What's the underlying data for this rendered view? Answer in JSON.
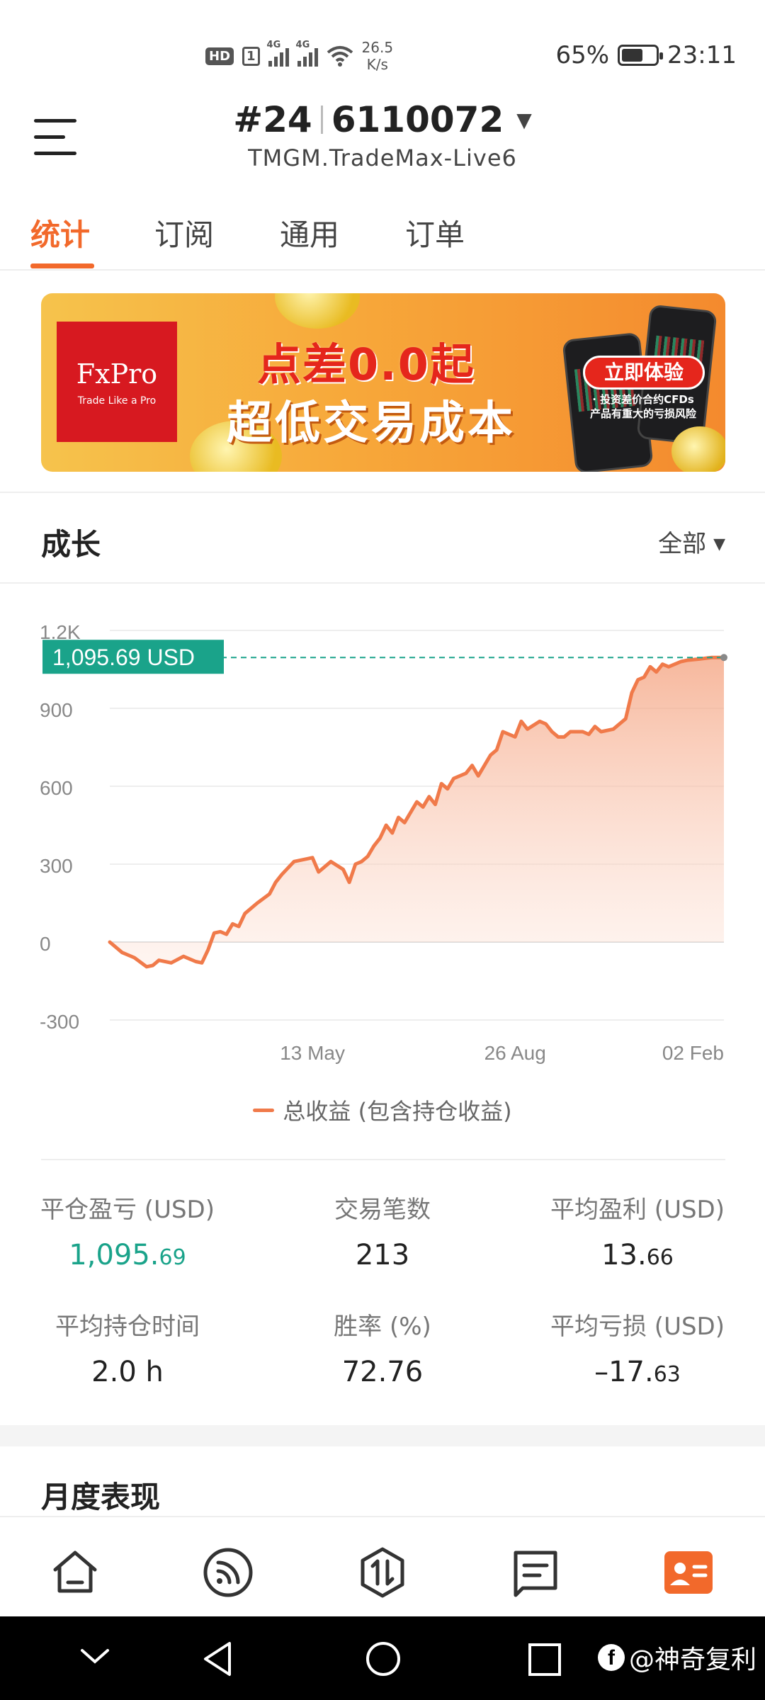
{
  "status_bar": {
    "hd": "HD",
    "sim": "1",
    "net1": "4G",
    "net2": "4G",
    "speed_value": "26.5",
    "speed_unit": "K/s",
    "battery": "65%",
    "time": "23:11"
  },
  "header": {
    "account_index": "#24",
    "account_number": "6110072",
    "server": "TMGM.TradeMax-Live6"
  },
  "tabs": [
    {
      "label": "统计",
      "active": true
    },
    {
      "label": "订阅",
      "active": false
    },
    {
      "label": "通用",
      "active": false
    },
    {
      "label": "订单",
      "active": false
    }
  ],
  "banner": {
    "brand": "FxPro",
    "brand_tagline": "Trade Like a Pro",
    "line1": "点差0.0起",
    "line2": "超低交易成本",
    "cta": "立即体验",
    "cta_note1": "· 投资差价合约CFDs",
    "cta_note2": "产品有重大的亏损风险"
  },
  "growth": {
    "title": "成长",
    "range": "全部"
  },
  "chart_data": {
    "type": "area",
    "ylim": [
      -300,
      1200
    ],
    "y_ticks": [
      "1.2K",
      "900",
      "600",
      "300",
      "0",
      "-300"
    ],
    "y_tick_values": [
      1200,
      900,
      600,
      300,
      0,
      -300
    ],
    "x_tick_labels": [
      "13 May",
      "26 Aug",
      "02 Feb"
    ],
    "x_tick_positions": [
      0.33,
      0.66,
      1.0
    ],
    "current_value_label": "1,095.69 USD",
    "current_value": 1095.69,
    "legend": "总收益 (包含持仓收益)",
    "line_color": "#f07a4a",
    "value_line_color": "#1aa38a",
    "series": [
      {
        "name": "总收益 (包含持仓收益)",
        "x": [
          0,
          0.02,
          0.04,
          0.06,
          0.07,
          0.08,
          0.1,
          0.12,
          0.14,
          0.15,
          0.16,
          0.17,
          0.18,
          0.19,
          0.2,
          0.21,
          0.22,
          0.24,
          0.26,
          0.27,
          0.28,
          0.3,
          0.32,
          0.33,
          0.34,
          0.36,
          0.38,
          0.39,
          0.4,
          0.41,
          0.42,
          0.43,
          0.44,
          0.45,
          0.46,
          0.47,
          0.48,
          0.5,
          0.51,
          0.52,
          0.53,
          0.54,
          0.55,
          0.56,
          0.58,
          0.59,
          0.6,
          0.62,
          0.63,
          0.64,
          0.66,
          0.67,
          0.68,
          0.7,
          0.71,
          0.72,
          0.73,
          0.74,
          0.75,
          0.77,
          0.78,
          0.79,
          0.8,
          0.82,
          0.84,
          0.85,
          0.86,
          0.87,
          0.88,
          0.89,
          0.9,
          0.91,
          0.92,
          0.93,
          0.94,
          0.96,
          0.98,
          1.0
        ],
        "values": [
          0,
          -40,
          -60,
          -95,
          -90,
          -70,
          -80,
          -55,
          -75,
          -80,
          -30,
          35,
          40,
          30,
          70,
          60,
          110,
          150,
          185,
          230,
          260,
          310,
          320,
          325,
          270,
          310,
          280,
          230,
          300,
          310,
          330,
          370,
          400,
          450,
          420,
          480,
          460,
          540,
          520,
          560,
          530,
          610,
          590,
          630,
          650,
          680,
          640,
          720,
          740,
          810,
          790,
          850,
          820,
          850,
          840,
          810,
          790,
          790,
          810,
          810,
          800,
          830,
          810,
          820,
          860,
          960,
          1010,
          1020,
          1060,
          1040,
          1070,
          1060,
          1070,
          1080,
          1085,
          1090,
          1095.69,
          1095.69
        ]
      }
    ]
  },
  "stats": [
    {
      "label": "平仓盈亏 (USD)",
      "int": "1,095.",
      "dec": "69",
      "color": "green"
    },
    {
      "label": "交易笔数",
      "int": "213",
      "dec": "",
      "color": "default"
    },
    {
      "label": "平均盈利 (USD)",
      "int": "13.",
      "dec": "66",
      "color": "default"
    },
    {
      "label": "平均持仓时间",
      "int": "2.0 h",
      "dec": "",
      "color": "default"
    },
    {
      "label": "胜率 (%)",
      "int": "72.76",
      "dec": "",
      "color": "default"
    },
    {
      "label": "平均亏损 (USD)",
      "int": "–17.",
      "dec": "63",
      "color": "default"
    }
  ],
  "monthly": {
    "title": "月度表现"
  },
  "bottom_nav": [
    {
      "icon": "home-icon"
    },
    {
      "icon": "signal-feed-icon"
    },
    {
      "icon": "trade-icon"
    },
    {
      "icon": "messages-icon"
    },
    {
      "icon": "profile-card-icon",
      "active": true,
      "active_color": "#f2692b"
    }
  ],
  "watermark": "@神奇复利"
}
